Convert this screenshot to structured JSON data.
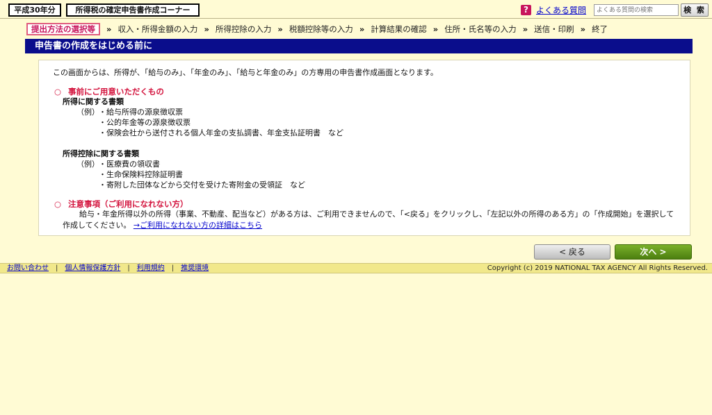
{
  "header": {
    "year_badge": "平成30年分",
    "corner_title": "所得税の確定申告書作成コーナー",
    "faq_icon": "?",
    "faq_link": "よくある質問",
    "faq_search_placeholder": "よくある質問の検索",
    "search_button": "検 索"
  },
  "steps": [
    {
      "label": "提出方法の選択等",
      "current": true
    },
    {
      "label": "収入・所得金額の入力"
    },
    {
      "label": "所得控除の入力"
    },
    {
      "label": "税額控除等の入力"
    },
    {
      "label": "計算結果の確認"
    },
    {
      "label": "住所・氏名等の入力"
    },
    {
      "label": "送信・印刷"
    },
    {
      "label": "終了"
    }
  ],
  "step_separator": "»",
  "page_title": "申告書の作成をはじめる前に",
  "content": {
    "intro": "この画面からは、所得が、「給与のみ」、「年金のみ」、「給与と年金のみ」の方専用の申告書作成画面となります。",
    "section1": {
      "marker": "○",
      "heading": "事前にご用意いただくもの",
      "group1": {
        "title": "所得に関する書類",
        "example_label": "（例）",
        "items": [
          "・給与所得の源泉徴収票",
          "・公的年金等の源泉徴収票",
          "・保険会社から送付される個人年金の支払調書、年金支払証明書　など"
        ]
      },
      "group2": {
        "title": "所得控除に関する書類",
        "example_label": "（例）",
        "items": [
          "・医療費の領収書",
          "・生命保険料控除証明書",
          "・寄附した団体などから交付を受けた寄附金の受領証　など"
        ]
      }
    },
    "section2": {
      "marker": "○",
      "heading": "注意事項（ご利用になれない方）",
      "text": "給与・年金所得以外の所得（事業、不動産、配当など）がある方は、ご利用できませんので、「<戻る」をクリックし、「左記以外の所得のある方」の「作成開始」を選択して作成してください。",
      "link": "→ご利用になれない方の詳細はこちら"
    }
  },
  "buttons": {
    "back": "< 戻る",
    "next": "次へ >"
  },
  "footer": {
    "links": [
      "お問い合わせ",
      "個人情報保護方針",
      "利用規約",
      "推奨環境"
    ],
    "separator": "|",
    "copyright": "Copyright (c) 2019 NATIONAL TAX AGENCY All Rights Reserved."
  }
}
